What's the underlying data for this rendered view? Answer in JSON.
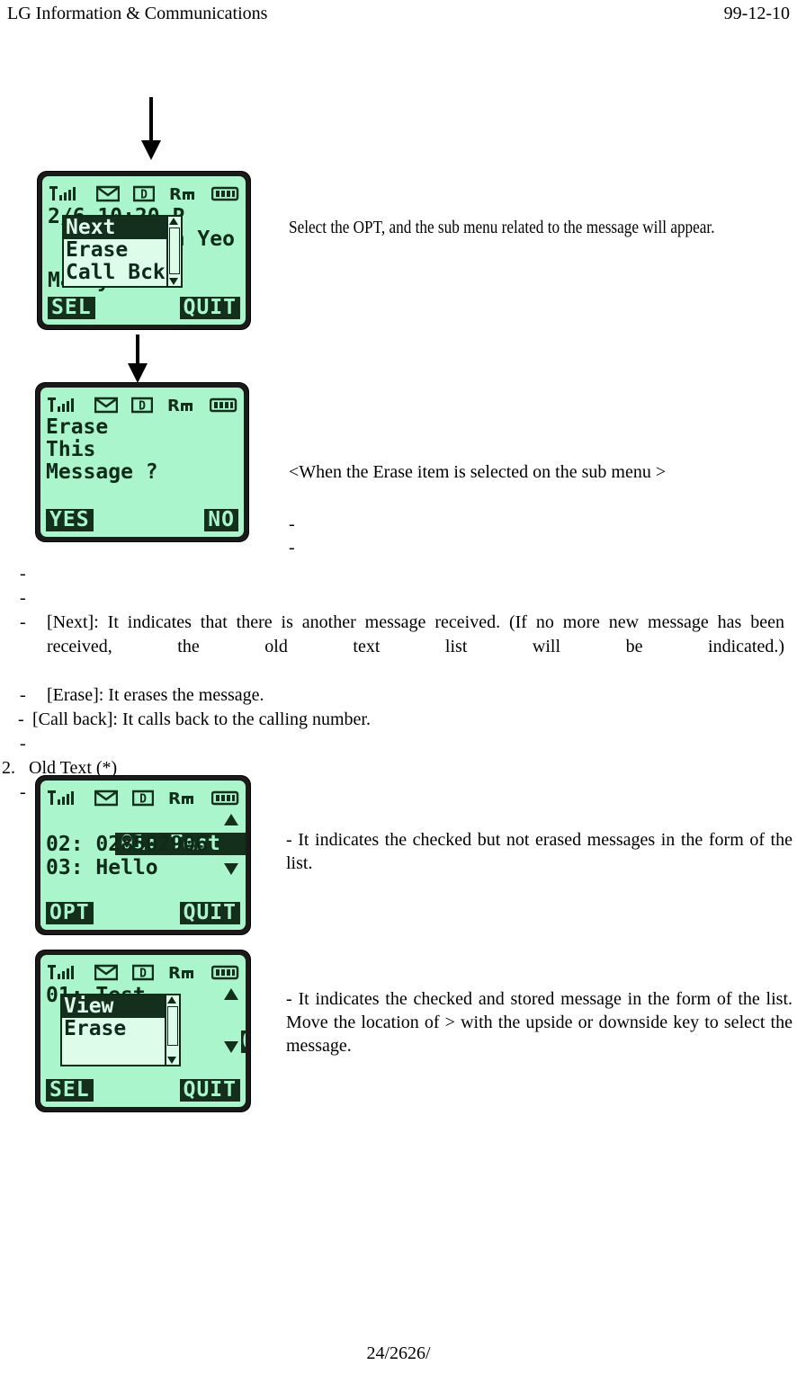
{
  "header": {
    "company": "LG Information & Communications",
    "date": "99-12-10"
  },
  "footer": {
    "page": "24/2626/"
  },
  "status_icons": {
    "signal": "signal-bars-icon",
    "message": "envelope-icon",
    "digital": "digital-d-icon",
    "roaming": "roaming-rm-icon",
    "battery": "battery-icon"
  },
  "screens": [
    {
      "name": "message-view-with-submenu",
      "bg_lines": [
        "2/6 10:20 P",
        "jin Yeo",
        "Marry me..."
      ],
      "popup": {
        "items": [
          {
            "label": "Next",
            "selected": true
          },
          {
            "label": "Erase",
            "selected": false
          },
          {
            "label": "Call Bck",
            "selected": false
          }
        ],
        "scroll_up": "scroll-up-arrow-icon",
        "scroll_down": "scroll-down-arrow-icon"
      },
      "softkey_left": "SEL",
      "softkey_right": "QUIT"
    },
    {
      "name": "erase-confirm",
      "lines": [
        "Erase",
        "This",
        "Message ?"
      ],
      "softkey_left": "YES",
      "softkey_right": "NO"
    },
    {
      "name": "old-text-list",
      "items": [
        {
          "label": "01: Test",
          "selected": true
        },
        {
          "label": "02: 028502906",
          "selected": false
        },
        {
          "label": "03: Hello",
          "selected": false
        }
      ],
      "scroll_up": "scroll-up-arrow-icon",
      "scroll_down": "scroll-down-arrow-icon",
      "softkey_left": "OPT",
      "softkey_right": "QUIT"
    },
    {
      "name": "old-text-list-with-submenu",
      "bg_lines": [
        "01: Test",
        "02906",
        "o"
      ],
      "popup": {
        "items": [
          {
            "label": "View",
            "selected": true
          },
          {
            "label": "Erase",
            "selected": false
          }
        ],
        "scroll_up": "scroll-up-arrow-icon",
        "scroll_down": "scroll-down-arrow-icon"
      },
      "scroll_up": "scroll-up-arrow-icon",
      "scroll_down": "scroll-down-arrow-icon",
      "softkey_left": "SEL",
      "softkey_right": "QUIT"
    }
  ],
  "notes": {
    "opt_note": "Select the OPT, and the sub menu related to the message will appear.",
    "erase_caption": "<When the Erase item is selected on the sub menu >",
    "erase_dash_1": "-",
    "erase_dash_2": "-",
    "list_note": "- It indicates the checked but not erased messages in the form of the list.",
    "submenu_note": "- It indicates the checked and stored message in the form of the list. Move the location of > with the upside or downside key to select the message."
  },
  "bullets": {
    "dash_1": "-",
    "dash_2": "-",
    "next_dash": "-",
    "next_text": "[Next]: It indicates that there is another message received. (If no more new message has been received, the old text list will be indicated.)",
    "erase_dash": "-",
    "erase_text": "[Erase]: It erases the message.",
    "callback_dash": "-",
    "callback_text": "[Call back]: It calls back to the calling number.",
    "dash_3": "-",
    "section_number": "2.",
    "section_title": "Old Text (*)",
    "dash_4": "-"
  },
  "colors": {
    "lcd_background": "#aaf5cc",
    "lcd_ink": "#0d2b18",
    "frame": "#1a1a1a",
    "page_background": "#ffffff"
  }
}
